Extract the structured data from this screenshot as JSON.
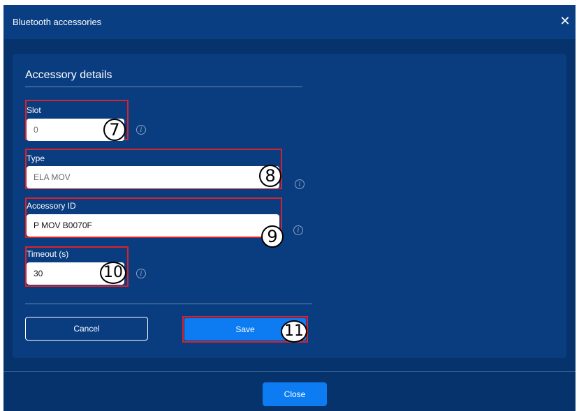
{
  "dialog": {
    "title": "Bluetooth accessories",
    "close_icon": "close-icon",
    "close_button_label": "Close"
  },
  "section": {
    "title": "Accessory details"
  },
  "fields": {
    "slot": {
      "label": "Slot",
      "value": "0",
      "badge": "7"
    },
    "type": {
      "label": "Type",
      "value": "ELA MOV",
      "badge": "8"
    },
    "accessory_id": {
      "label": "Accessory ID",
      "value": "P MOV B0070F",
      "badge": "9"
    },
    "timeout": {
      "label": "Timeout (s)",
      "value": "30",
      "badge": "10"
    }
  },
  "actions": {
    "cancel_label": "Cancel",
    "save_label": "Save",
    "save_badge": "11"
  },
  "icons": {
    "info": "info-icon"
  },
  "colors": {
    "background": "#06336b",
    "titlebar": "#0a3e82",
    "panel": "#0a3d80",
    "primary_button": "#0d7cf2",
    "highlight_frame": "#d8232a"
  }
}
